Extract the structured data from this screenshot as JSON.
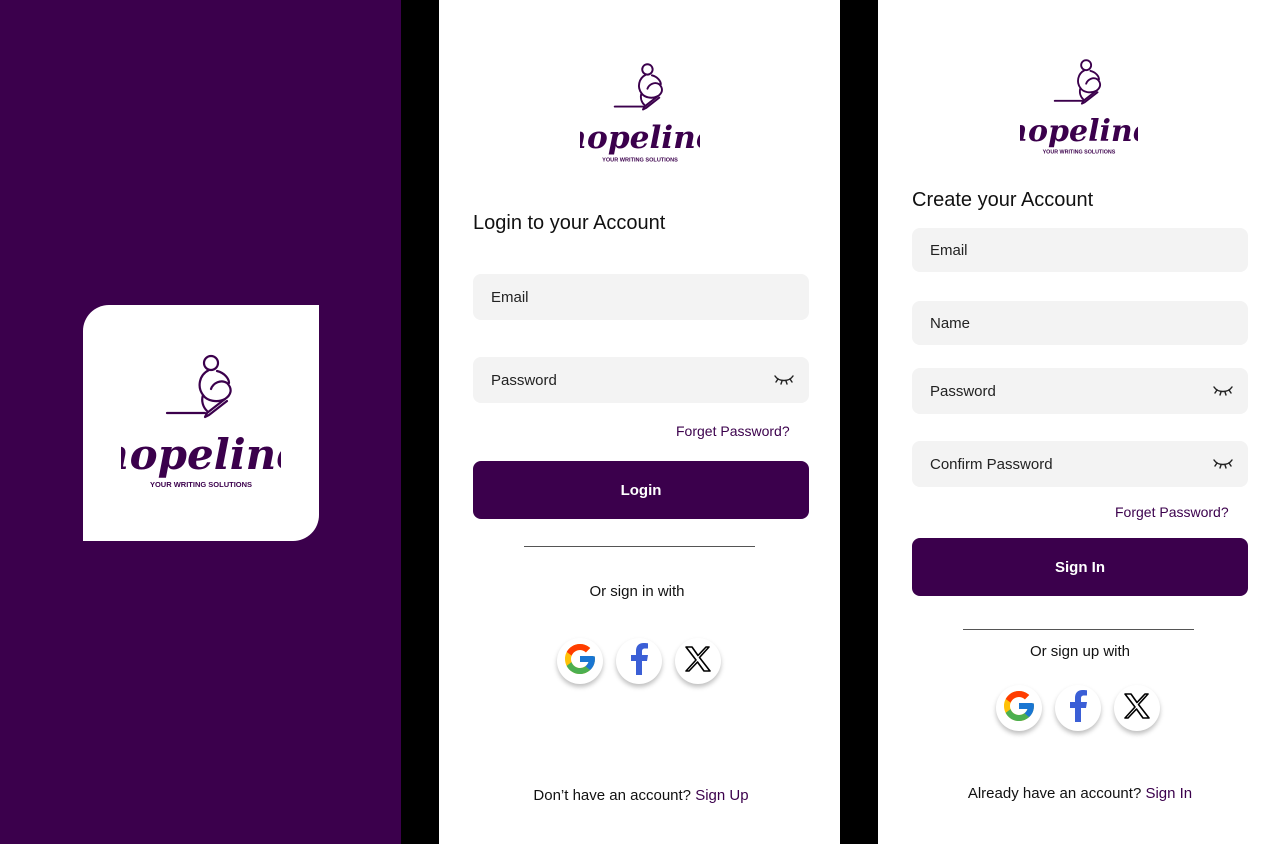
{
  "brand": {
    "name": "hopeline",
    "tagline": "YOUR WRITING SOLUTIONS",
    "color": "#3b004c"
  },
  "login": {
    "title": "Login to your Account",
    "email_placeholder": "Email",
    "password_placeholder": "Password",
    "forgot_link": "Forget Password?",
    "submit_label": "Login",
    "social_caption": "Or sign in with",
    "footer_text": "Don’t have an account?",
    "footer_link": "Sign Up"
  },
  "signup": {
    "title": "Create your Account",
    "email_placeholder": "Email",
    "name_placeholder": "Name",
    "password_placeholder": "Password",
    "confirm_placeholder": "Confirm Password",
    "forgot_link": "Forget Password?",
    "submit_label": "Sign In",
    "social_caption": "Or sign up with",
    "footer_text": "Already have an account?",
    "footer_link": "Sign In"
  },
  "icons": {
    "password_toggle": "eye-closed-icon",
    "social": [
      "google-icon",
      "facebook-icon",
      "x-icon"
    ]
  }
}
